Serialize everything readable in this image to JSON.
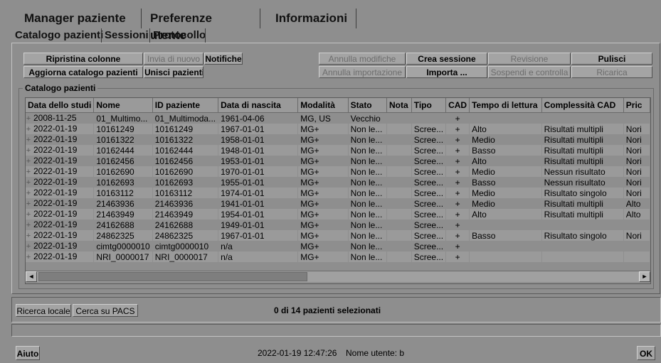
{
  "top_tabs": [
    "Manager paziente",
    "Preferenze utente",
    "Informazioni"
  ],
  "sub_tabs": [
    "Catalogo pazienti",
    "Sessioni",
    "Protocollo"
  ],
  "toolbar": {
    "ripristina": "Ripristina colonne",
    "invia": "Invia di nuovo",
    "notifiche": "Notifiche",
    "aggiorna": "Aggiorna catalogo pazienti",
    "unisci": "Unisci pazienti",
    "annulla_modifiche": "Annulla modifiche",
    "crea_sessione": "Crea sessione",
    "revisione": "Revisione",
    "pulisci": "Pulisci",
    "annulla_importazione": "Annulla importazione",
    "importa": "Importa ...",
    "sospendi": "Sospendi e controlla",
    "ricarica": "Ricarica"
  },
  "catalog_title": "Catalogo pazienti",
  "columns": [
    "Data dello studi",
    "Nome",
    "ID paziente",
    "Data di nascita",
    "Modalità",
    "Stato",
    "Nota",
    "Tipo",
    "CAD",
    "Tempo di lettura",
    "Complessità CAD",
    "Pric"
  ],
  "expander_symbol": "+",
  "rows": [
    [
      "2008-11-25",
      "01_Multimo...",
      "01_Multimoda...",
      "1961-04-06",
      "MG, US",
      "Vecchio",
      "",
      "",
      "+",
      "",
      "",
      ""
    ],
    [
      "2022-01-19",
      "10161249",
      "10161249",
      "1967-01-01",
      "MG+",
      "Non le...",
      "",
      "Scree...",
      "+",
      "Alto",
      "Risultati multipli",
      "Nori"
    ],
    [
      "2022-01-19",
      "10161322",
      "10161322",
      "1958-01-01",
      "MG+",
      "Non le...",
      "",
      "Scree...",
      "+",
      "Medio",
      "Risultati multipli",
      "Nori"
    ],
    [
      "2022-01-19",
      "10162444",
      "10162444",
      "1948-01-01",
      "MG+",
      "Non le...",
      "",
      "Scree...",
      "+",
      "Basso",
      "Risultati multipli",
      "Nori"
    ],
    [
      "2022-01-19",
      "10162456",
      "10162456",
      "1953-01-01",
      "MG+",
      "Non le...",
      "",
      "Scree...",
      "+",
      "Alto",
      "Risultati multipli",
      "Nori"
    ],
    [
      "2022-01-19",
      "10162690",
      "10162690",
      "1970-01-01",
      "MG+",
      "Non le...",
      "",
      "Scree...",
      "+",
      "Medio",
      "Nessun risultato",
      "Nori"
    ],
    [
      "2022-01-19",
      "10162693",
      "10162693",
      "1955-01-01",
      "MG+",
      "Non le...",
      "",
      "Scree...",
      "+",
      "Basso",
      "Nessun risultato",
      "Nori"
    ],
    [
      "2022-01-19",
      "10163112",
      "10163112",
      "1974-01-01",
      "MG+",
      "Non le...",
      "",
      "Scree...",
      "+",
      "Medio",
      "Risultato singolo",
      "Nori"
    ],
    [
      "2022-01-19",
      "21463936",
      "21463936",
      "1941-01-01",
      "MG+",
      "Non le...",
      "",
      "Scree...",
      "+",
      "Medio",
      "Risultati multipli",
      "Alto"
    ],
    [
      "2022-01-19",
      "21463949",
      "21463949",
      "1954-01-01",
      "MG+",
      "Non le...",
      "",
      "Scree...",
      "+",
      "Alto",
      "Risultati multipli",
      "Alto"
    ],
    [
      "2022-01-19",
      "24162688",
      "24162688",
      "1949-01-01",
      "MG+",
      "Non le...",
      "",
      "Scree...",
      "+",
      "",
      "",
      ""
    ],
    [
      "2022-01-19",
      "24862325",
      "24862325",
      "1967-01-01",
      "MG+",
      "Non le...",
      "",
      "Scree...",
      "+",
      "Basso",
      "Risultato singolo",
      "Nori"
    ],
    [
      "2022-01-19",
      "cimtg0000010",
      "cimtg0000010",
      "n/a",
      "MG+",
      "Non le...",
      "",
      "Scree...",
      "+",
      "",
      "",
      ""
    ],
    [
      "2022-01-19",
      "NRI_0000017",
      "NRI_0000017",
      "n/a",
      "MG+",
      "Non le...",
      "",
      "Scree...",
      "+",
      "",
      "",
      ""
    ]
  ],
  "search": {
    "local": "Ricerca locale",
    "pacs": "Cerca su PACS"
  },
  "selection_status": "0 di 14 pazienti selezionati",
  "footer": {
    "help": "Aiuto",
    "datetime": "2022-01-19  12:47:26",
    "user": "Nome utente:  b",
    "ok": "OK"
  },
  "scroll_left_icon": "◄",
  "scroll_right_icon": "►"
}
